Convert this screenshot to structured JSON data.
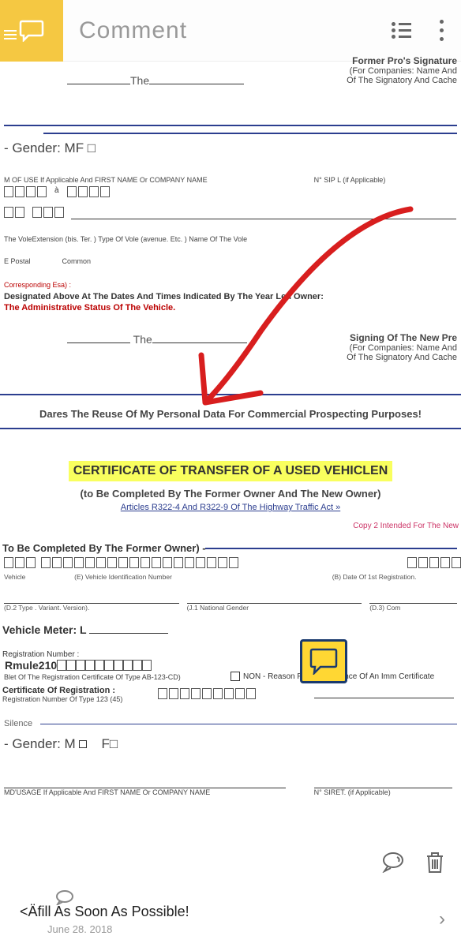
{
  "header": {
    "title": "Comment"
  },
  "doc": {
    "the1": "The",
    "sig1_l1": "Former Pro's Signature",
    "sig1_l2": "(For Companies: Name And",
    "sig1_l3": "Of The Signatory And Cache",
    "gender1": " - Gender: MF □",
    "use_label": "M OF USE If Applicable And FIRST NAME Or COMPANY NAME",
    "sip": "N° SIP L (if Applicable)",
    "a_char": "à",
    "vole_ext": "The VoleExtension (bis. Ter. ) Type Of Vole (avenue. Etc. ) Name Of The Vole",
    "postal": "E Postal",
    "common": "Common",
    "corresp": "Corresponding Esa) :",
    "designated": "Designated Above At The Dates And Times Indicated By The Year Len Owner:",
    "admin": "The Administrative Status Of The Vehicle.",
    "the2": "The",
    "sig2_l1": "Signing Of The New Pre",
    "sig2_l2": "(For Companies: Name And",
    "sig2_l3": "Of The Signatory And Cache",
    "prospect": "Dares The Reuse Of My Personal Data For Commercial Prospecting Purposes!",
    "cert_title": "CERTIFICATE OF TRANSFER OF A USED VEHICLEN",
    "cert_sub": "(to Be Completed By The Former Owner And The New Owner)",
    "cert_link": "Articles R322-4 And R322-9 Of The Highway Traffic Act »",
    "copy2": "Copy 2 Intended For The New",
    "section_former": "To Be Completed By The Former Owner) -",
    "vehicle": "Vehicle",
    "vin": "(E) Vehicle Identification Number",
    "date1st": "(B) Date Of 1st Registration.",
    "d2": "(D.2 Type . Variant. Version).",
    "j1": "(J.1 National Gender",
    "d3": "(D.3) Com",
    "meter": "Vehicle Meter: L",
    "reg_num": "Registration Number :",
    "rmule": "Rmule210",
    "blet": "Blet Of The Registration Certificate Of Type AB-123-CD)",
    "non": "NON - Reason For The Absence Of An Imm Certificate",
    "cert_reg": "Certificate Of Registration :",
    "reg_type": "Registration Number Of Type 123 (45)",
    "silence": "Silence",
    "gender2": " - Gender: M",
    "gender2_f": "F□",
    "md_usage": "MD'USAGE If Applicable And FIRST NAME Or COMPANY NAME",
    "siret": "N° SIRET. (if Applicable)"
  },
  "footer": {
    "msg": "<Äfill As Soon As Possible!",
    "date": "June 28. 2018"
  }
}
